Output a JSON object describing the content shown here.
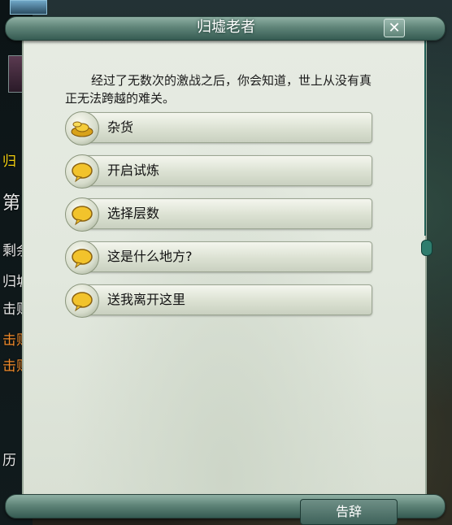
{
  "dialog": {
    "title": "归墟老者",
    "close_label": "✕",
    "intro": "经过了无数次的激战之后，你会知道，世上从没有真正无法跨越的难关。",
    "options": [
      {
        "label": "杂货",
        "icon": "gold-ingot-icon"
      },
      {
        "label": "开启试炼",
        "icon": "speech-bubble-icon"
      },
      {
        "label": "选择层数",
        "icon": "speech-bubble-icon"
      },
      {
        "label": "这是什么地方?",
        "icon": "speech-bubble-icon"
      },
      {
        "label": "送我离开这里",
        "icon": "speech-bubble-icon"
      }
    ],
    "farewell_label": "告辞"
  },
  "sidebar": {
    "items": [
      "归",
      "第",
      "剩余",
      "归墟",
      "击败",
      "击败",
      "击败",
      "历"
    ]
  },
  "colors": {
    "scroll_paper": "#e3e9df",
    "scroll_rod": "#5f8478",
    "accent_yellow": "#f4d010",
    "accent_orange": "#f08a2a"
  }
}
